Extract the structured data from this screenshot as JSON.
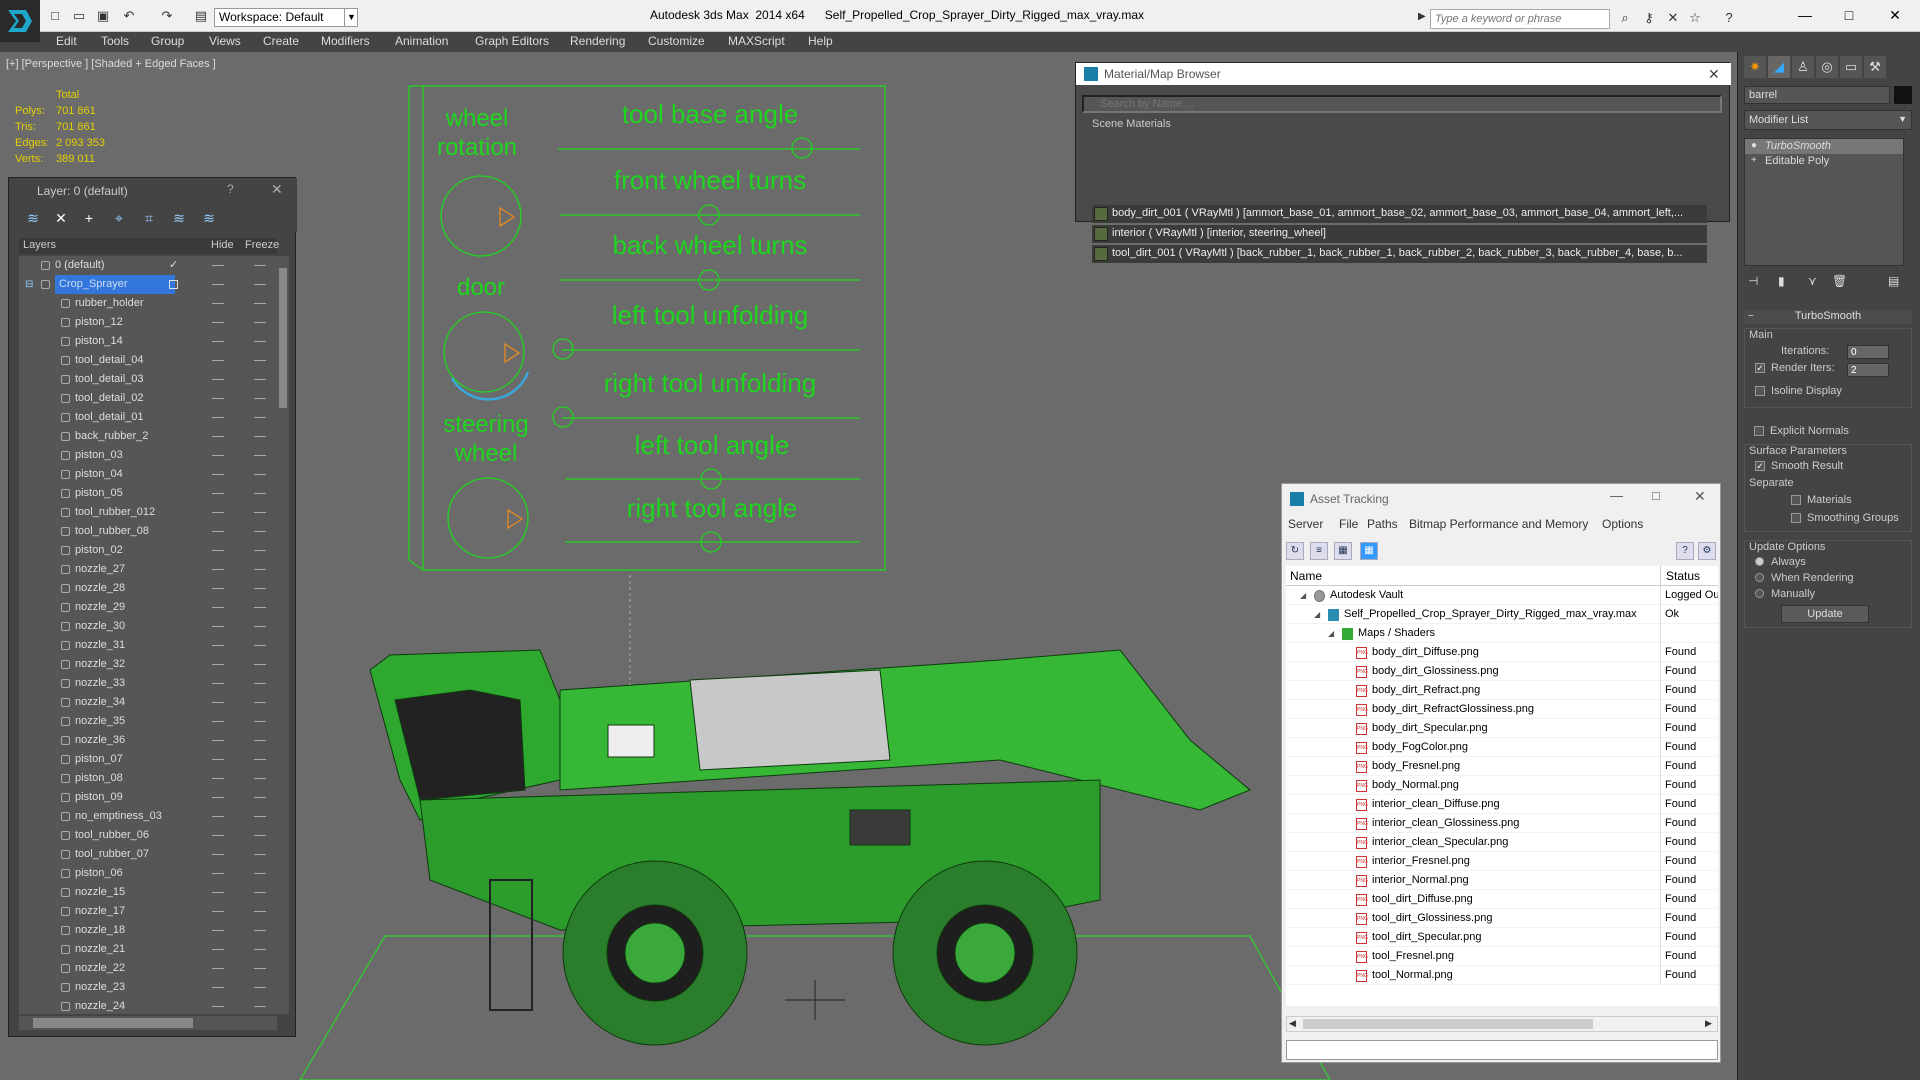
{
  "app": {
    "title": "Autodesk 3ds Max  2014 x64      Self_Propelled_Crop_Sprayer_Dirty_Rigged_max_vray.max",
    "workspace": "Workspace: Default",
    "search_placeholder": "Type a keyword or phrase"
  },
  "menu": [
    "Edit",
    "Tools",
    "Group",
    "Views",
    "Create",
    "Modifiers",
    "Animation",
    "Graph Editors",
    "Rendering",
    "Customize",
    "MAXScript",
    "Help"
  ],
  "viewport": {
    "label": "[+] [Perspective ] [Shaded + Edged Faces ]",
    "stats_header": "Total",
    "stats": [
      {
        "label": "Polys:",
        "value": "701 861"
      },
      {
        "label": "Tris:",
        "value": "701 861"
      },
      {
        "label": "Edges:",
        "value": "2 093 353"
      },
      {
        "label": "Verts:",
        "value": "389 011"
      }
    ],
    "rig": {
      "wheel_rotation": "wheel rotation",
      "door": "door",
      "steering_wheel": "steering wheel",
      "sliders": [
        "tool base angle",
        "front wheel turns",
        "back wheel turns",
        "left tool unfolding",
        "right tool unfolding",
        "left tool angle",
        "right tool angle"
      ]
    },
    "colors": {
      "rig": "#1fd61f",
      "mesh": "#2fb82f",
      "background": "#6b6b6b"
    }
  },
  "layers": {
    "title": "Layer: 0 (default)",
    "help": "?",
    "columns": {
      "name": "Layers",
      "hide": "Hide",
      "freeze": "Freeze"
    },
    "items": [
      {
        "name": "0 (default)",
        "level": 0
      },
      {
        "name": "Crop_Sprayer",
        "level": 0,
        "selected": true
      },
      {
        "name": "rubber_holder",
        "level": 1
      },
      {
        "name": "piston_12",
        "level": 1
      },
      {
        "name": "piston_14",
        "level": 1
      },
      {
        "name": "tool_detail_04",
        "level": 1
      },
      {
        "name": "tool_detail_03",
        "level": 1
      },
      {
        "name": "tool_detail_02",
        "level": 1
      },
      {
        "name": "tool_detail_01",
        "level": 1
      },
      {
        "name": "back_rubber_2",
        "level": 1
      },
      {
        "name": "piston_03",
        "level": 1
      },
      {
        "name": "piston_04",
        "level": 1
      },
      {
        "name": "piston_05",
        "level": 1
      },
      {
        "name": "tool_rubber_012",
        "level": 1
      },
      {
        "name": "tool_rubber_08",
        "level": 1
      },
      {
        "name": "piston_02",
        "level": 1
      },
      {
        "name": "nozzle_27",
        "level": 1
      },
      {
        "name": "nozzle_28",
        "level": 1
      },
      {
        "name": "nozzle_29",
        "level": 1
      },
      {
        "name": "nozzle_30",
        "level": 1
      },
      {
        "name": "nozzle_31",
        "level": 1
      },
      {
        "name": "nozzle_32",
        "level": 1
      },
      {
        "name": "nozzle_33",
        "level": 1
      },
      {
        "name": "nozzle_34",
        "level": 1
      },
      {
        "name": "nozzle_35",
        "level": 1
      },
      {
        "name": "nozzle_36",
        "level": 1
      },
      {
        "name": "piston_07",
        "level": 1
      },
      {
        "name": "piston_08",
        "level": 1
      },
      {
        "name": "piston_09",
        "level": 1
      },
      {
        "name": "no_emptiness_03",
        "level": 1
      },
      {
        "name": "tool_rubber_06",
        "level": 1
      },
      {
        "name": "tool_rubber_07",
        "level": 1
      },
      {
        "name": "piston_06",
        "level": 1
      },
      {
        "name": "nozzle_15",
        "level": 1
      },
      {
        "name": "nozzle_17",
        "level": 1
      },
      {
        "name": "nozzle_18",
        "level": 1
      },
      {
        "name": "nozzle_21",
        "level": 1
      },
      {
        "name": "nozzle_22",
        "level": 1
      },
      {
        "name": "nozzle_23",
        "level": 1
      },
      {
        "name": "nozzle_24",
        "level": 1
      }
    ]
  },
  "material_browser": {
    "title": "Material/Map Browser",
    "search": "Search by Name ...",
    "section": "Scene Materials",
    "items": [
      "body_dirt_001  ( VRayMtl ) [ammort_base_01, ammort_base_02, ammort_base_03, ammort_base_04, ammort_left,...",
      "interior  ( VRayMtl ) [interior, steering_wheel]",
      "tool_dirt_001  ( VRayMtl ) [back_rubber_1, back_rubber_1, back_rubber_2, back_rubber_3, back_rubber_4, base, b..."
    ]
  },
  "asset_tracking": {
    "title": "Asset Tracking",
    "menu": [
      "Server",
      "File",
      "Paths",
      "Bitmap Performance and Memory",
      "Options"
    ],
    "columns": {
      "name": "Name",
      "status": "Status"
    },
    "items": [
      {
        "name": "Autodesk Vault",
        "status": "Logged Ou",
        "indent": 0,
        "icon": "vault-icon"
      },
      {
        "name": "Self_Propelled_Crop_Sprayer_Dirty_Rigged_max_vray.max",
        "status": "Ok",
        "indent": 1,
        "icon": "max-file-icon"
      },
      {
        "name": "Maps / Shaders",
        "status": "",
        "indent": 2,
        "icon": "folder-icon"
      },
      {
        "name": "body_dirt_Diffuse.png",
        "status": "Found",
        "indent": 3,
        "icon": "png-icon"
      },
      {
        "name": "body_dirt_Glossiness.png",
        "status": "Found",
        "indent": 3,
        "icon": "png-icon"
      },
      {
        "name": "body_dirt_Refract.png",
        "status": "Found",
        "indent": 3,
        "icon": "png-icon"
      },
      {
        "name": "body_dirt_RefractGlossiness.png",
        "status": "Found",
        "indent": 3,
        "icon": "png-icon"
      },
      {
        "name": "body_dirt_Specular.png",
        "status": "Found",
        "indent": 3,
        "icon": "png-icon"
      },
      {
        "name": "body_FogColor.png",
        "status": "Found",
        "indent": 3,
        "icon": "png-icon"
      },
      {
        "name": "body_Fresnel.png",
        "status": "Found",
        "indent": 3,
        "icon": "png-icon"
      },
      {
        "name": "body_Normal.png",
        "status": "Found",
        "indent": 3,
        "icon": "png-icon"
      },
      {
        "name": "interior_clean_Diffuse.png",
        "status": "Found",
        "indent": 3,
        "icon": "png-icon"
      },
      {
        "name": "interior_clean_Glossiness.png",
        "status": "Found",
        "indent": 3,
        "icon": "png-icon"
      },
      {
        "name": "interior_clean_Specular.png",
        "status": "Found",
        "indent": 3,
        "icon": "png-icon"
      },
      {
        "name": "interior_Fresnel.png",
        "status": "Found",
        "indent": 3,
        "icon": "png-icon"
      },
      {
        "name": "interior_Normal.png",
        "status": "Found",
        "indent": 3,
        "icon": "png-icon"
      },
      {
        "name": "tool_dirt_Diffuse.png",
        "status": "Found",
        "indent": 3,
        "icon": "png-icon"
      },
      {
        "name": "tool_dirt_Glossiness.png",
        "status": "Found",
        "indent": 3,
        "icon": "png-icon"
      },
      {
        "name": "tool_dirt_Specular.png",
        "status": "Found",
        "indent": 3,
        "icon": "png-icon"
      },
      {
        "name": "tool_Fresnel.png",
        "status": "Found",
        "indent": 3,
        "icon": "png-icon"
      },
      {
        "name": "tool_Normal.png",
        "status": "Found",
        "indent": 3,
        "icon": "png-icon"
      }
    ]
  },
  "command_panel": {
    "object_name": "barrel",
    "modifier_list": "Modifier List",
    "stack": [
      "TurboSmooth",
      "Editable Poly"
    ],
    "rollout_title": "TurboSmooth",
    "main_label": "Main",
    "iterations_label": "Iterations:",
    "iterations": "0",
    "render_iters_label": "Render Iters:",
    "render_iters": "2",
    "render_iters_checked": true,
    "isoline_label": "Isoline Display",
    "explicit_normals_label": "Explicit Normals",
    "surface_label": "Surface Parameters",
    "smooth_result_label": "Smooth Result",
    "smooth_result_checked": true,
    "separate_label": "Separate",
    "materials_label": "Materials",
    "smoothing_groups_label": "Smoothing Groups",
    "update_options_label": "Update Options",
    "update_options": [
      "Always",
      "When Rendering",
      "Manually"
    ],
    "update_selected": "Always",
    "update_button": "Update"
  }
}
